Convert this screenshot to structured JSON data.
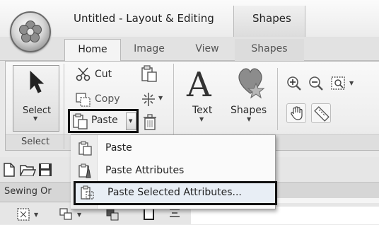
{
  "window": {
    "title": "Untitled - Layout & Editing",
    "context_tab": "Shapes"
  },
  "ribbon_tabs": {
    "home": "Home",
    "image": "Image",
    "view": "View",
    "shapes": "Shapes"
  },
  "clipboard": {
    "cut": "Cut",
    "copy": "Copy",
    "paste": "Paste"
  },
  "select_group": {
    "select_button": "Select",
    "label": "Select"
  },
  "text_shapes": {
    "text_button": "Text",
    "shapes_button": "Shapes",
    "group_label_fragment": "ls"
  },
  "sewing_tab": {
    "label": "Sewing Or"
  },
  "paste_menu": {
    "items": [
      "Paste",
      "Paste Attributes",
      "Paste Selected Attributes..."
    ]
  },
  "icons": {
    "app": "flower-app-icon",
    "cut": "scissors-icon",
    "copy": "copy-icon",
    "paste": "clipboard-icon",
    "paste_attributes": "clipboard-brush-icon",
    "delete": "trash-icon",
    "select": "arrow-cursor-icon",
    "text": "letter-a-icon",
    "shapes": "heart-star-icon",
    "zoom_in": "zoom-in-icon",
    "zoom_out": "zoom-out-icon",
    "pan": "hand-icon",
    "measure": "ruler-icon"
  }
}
